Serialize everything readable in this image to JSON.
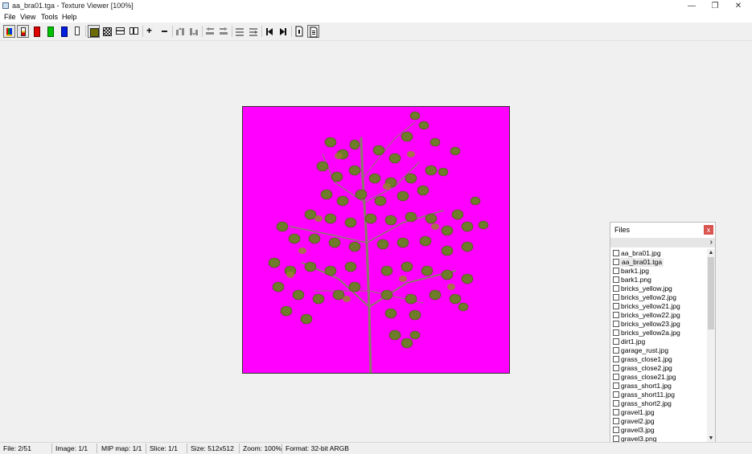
{
  "window": {
    "title": "aa_bra01.tga - Texture Viewer [100%]",
    "controls": {
      "minimize": "—",
      "restore": "❐",
      "close": "✕"
    }
  },
  "menu": [
    "File",
    "View",
    "Tools",
    "Help"
  ],
  "toolbar": {
    "buttons": [
      {
        "name": "rgb-channels",
        "icon": "rgb-bars-icon",
        "pressed": true
      },
      {
        "name": "alpha-channel",
        "icon": "alpha-bar-icon",
        "pressed": true
      },
      {
        "name": "red-channel",
        "icon": "red-bar-icon"
      },
      {
        "name": "green-channel",
        "icon": "green-bar-icon"
      },
      {
        "name": "blue-channel",
        "icon": "blue-bar-icon"
      },
      {
        "name": "white-channel",
        "icon": "white-bar-icon"
      },
      {
        "name": "background-color",
        "icon": "olive-square-icon"
      },
      {
        "name": "checker-background",
        "icon": "checker-icon"
      },
      {
        "name": "tile-horizontal",
        "icon": "tile-h-icon"
      },
      {
        "name": "tile-vertical",
        "icon": "tile-v-icon"
      },
      {
        "name": "zoom-in",
        "icon": "plus-icon"
      },
      {
        "name": "zoom-out",
        "icon": "minus-icon"
      },
      {
        "name": "mip-up",
        "icon": "mip-up-icon"
      },
      {
        "name": "mip-down",
        "icon": "mip-down-icon"
      },
      {
        "name": "slice-prev",
        "icon": "slice-prev-icon"
      },
      {
        "name": "slice-next",
        "icon": "slice-next-icon"
      },
      {
        "name": "file-prev",
        "icon": "file-prev-icon"
      },
      {
        "name": "file-next",
        "icon": "file-next-icon"
      },
      {
        "name": "first-file",
        "icon": "skip-first-icon"
      },
      {
        "name": "last-file",
        "icon": "skip-last-icon"
      },
      {
        "name": "file-info",
        "icon": "document-icon"
      },
      {
        "name": "file-list",
        "icon": "document-list-icon"
      }
    ]
  },
  "files_panel": {
    "title": "Files",
    "close_label": "x",
    "nav_chevron": "›",
    "selected_index": 1,
    "files": [
      "aa_bra01.jpg",
      "aa_bra01.tga",
      "bark1.jpg",
      "bark1.png",
      "bricks_yellow.jpg",
      "bricks_yellow2.jpg",
      "bricks_yellow21.jpg",
      "bricks_yellow22.jpg",
      "bricks_yellow23.jpg",
      "bricks_yellow2a.jpg",
      "dirt1.jpg",
      "garage_rust.jpg",
      "grass_close1.jpg",
      "grass_close2.jpg",
      "grass_close21.jpg",
      "grass_short1.jpg",
      "grass_short11.jpg",
      "grass_short2.jpg",
      "gravel1.jpg",
      "gravel2.jpg",
      "gravel3.jpg",
      "gravel3.png"
    ]
  },
  "status": {
    "file": "File: 2/51",
    "image": "Image: 1/1",
    "mip": "MIP map: 1/1",
    "slice": "Slice: 1/1",
    "size": "Size: 512x512",
    "zoom": "Zoom: 100%",
    "format": "Format: 32-bit ARGB"
  },
  "colors": {
    "canvas_background": "#ff00ff",
    "close_button": "#d9534f"
  }
}
